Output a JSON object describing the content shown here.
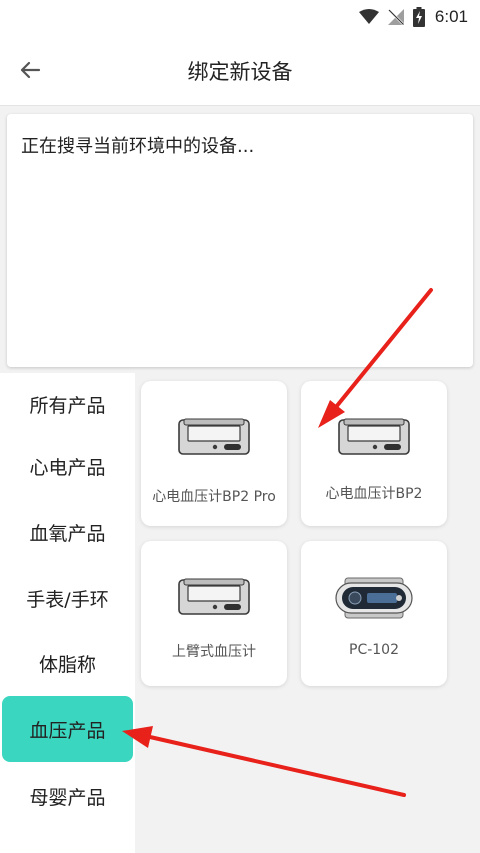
{
  "status_bar": {
    "time": "6:01"
  },
  "app_bar": {
    "title": "绑定新设备"
  },
  "search": {
    "status_text": "正在搜寻当前环境中的设备..."
  },
  "sidebar": {
    "items": [
      {
        "label": "所有产品"
      },
      {
        "label": "心电产品"
      },
      {
        "label": "血氧产品"
      },
      {
        "label": "手表/手环"
      },
      {
        "label": "体脂称"
      },
      {
        "label": "血压产品",
        "active": true
      },
      {
        "label": "母婴产品"
      }
    ]
  },
  "products": [
    {
      "label": "心电血压计BP2 Pro",
      "icon": "bp-monitor-icon"
    },
    {
      "label": "心电血压计BP2",
      "icon": "bp-monitor-icon"
    },
    {
      "label": "上臂式血压计",
      "icon": "bp-monitor-icon"
    },
    {
      "label": "PC-102",
      "icon": "pc102-device-icon"
    }
  ],
  "colors": {
    "accent": "#3bd6bf",
    "annotation_arrow": "#e8211b"
  }
}
